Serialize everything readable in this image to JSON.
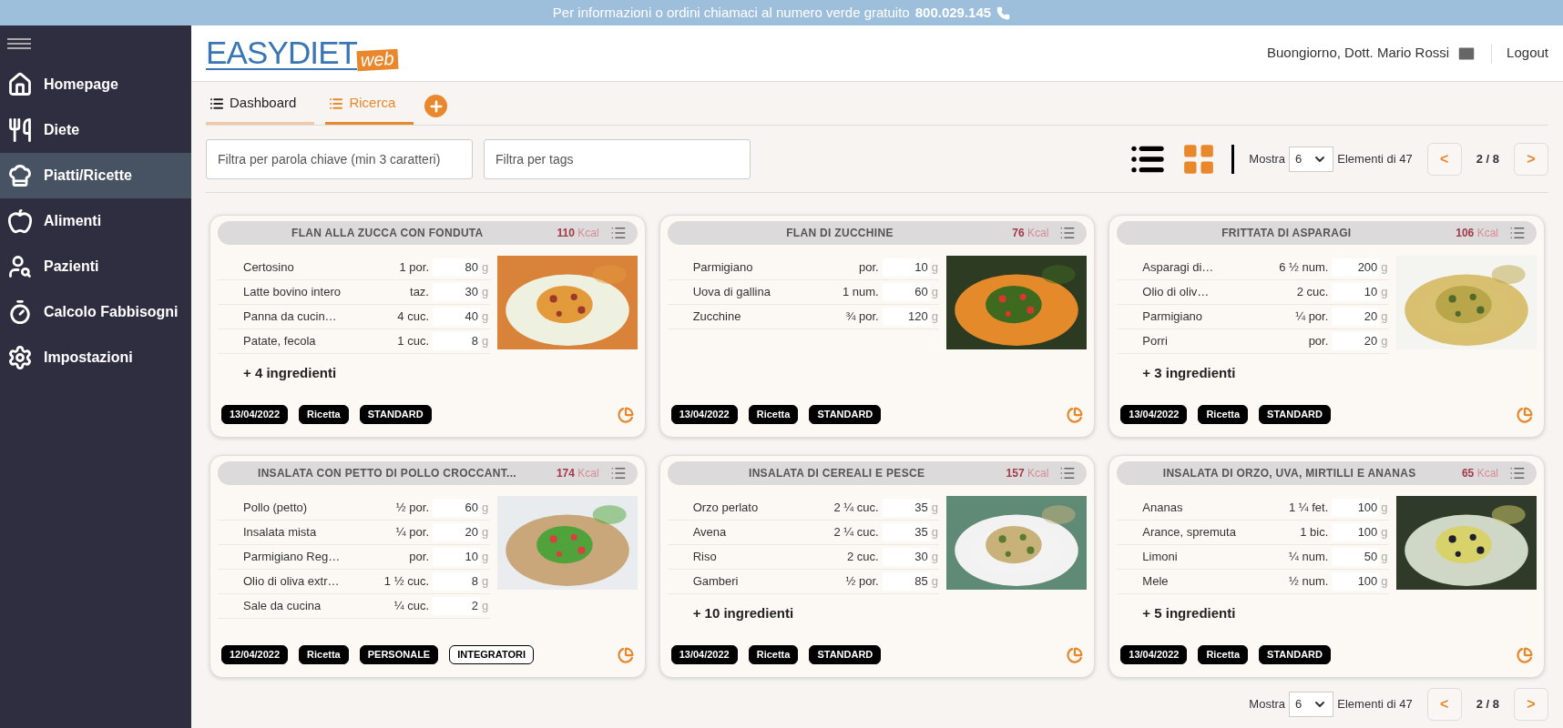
{
  "top_banner": {
    "text": "Per informazioni o ordini chiamaci al numero verde gratuito",
    "phone": "800.029.145"
  },
  "sidebar": {
    "items": [
      {
        "label": "Homepage",
        "selected": false
      },
      {
        "label": "Diete",
        "selected": false
      },
      {
        "label": "Piatti/Ricette",
        "selected": true
      },
      {
        "label": "Alimenti",
        "selected": false
      },
      {
        "label": "Pazienti",
        "selected": false
      },
      {
        "label": "Calcolo Fabbisogni",
        "selected": false
      },
      {
        "label": "Impostazioni",
        "selected": false
      }
    ]
  },
  "header": {
    "logo_main": "EASYDIET",
    "logo_badge": "web",
    "greeting": "Buongiorno, Dott. Mario Rossi",
    "logout": "Logout"
  },
  "tabs": [
    {
      "label": "Dashboard",
      "selected": false
    },
    {
      "label": "Ricerca",
      "selected": true
    }
  ],
  "filters": [
    {
      "placeholder": "Filtra per parola chiave (min 3 caratteri)"
    },
    {
      "placeholder": "Filtra per tags"
    }
  ],
  "view_modes": [
    {
      "kind": "list",
      "selected": false
    },
    {
      "kind": "grid",
      "selected": true
    }
  ],
  "pagination": {
    "show_label": "Mostra",
    "page_size": "6",
    "elements_label": "Elementi di",
    "total": "47",
    "prev": "<",
    "page": "2 / 8",
    "next": ">"
  },
  "cards": [
    {
      "title": "FLAN ALLA ZUCCA CON FONDUTA",
      "kcal": "110",
      "kcal_unit": "Kcal",
      "ingredients": [
        {
          "name": "Certosino",
          "qty": "1 por.",
          "grams": "80",
          "unit": "g"
        },
        {
          "name": "Latte bovino intero",
          "qty": "taz.",
          "grams": "30",
          "unit": "g"
        },
        {
          "name": "Panna da cucin…",
          "qty": "4 cuc.",
          "grams": "40",
          "unit": "g"
        },
        {
          "name": "Patate, fecola",
          "qty": "1 cuc.",
          "grams": "8",
          "unit": "g"
        }
      ],
      "more": "+ 4 ingredienti",
      "tags": [
        {
          "label": "13/04/2022",
          "outlined": false
        },
        {
          "label": "Ricetta",
          "outlined": false
        },
        {
          "label": "STANDARD",
          "outlined": false
        }
      ]
    },
    {
      "title": "FLAN DI ZUCCHINE",
      "kcal": "76",
      "kcal_unit": "Kcal",
      "ingredients": [
        {
          "name": "Parmigiano",
          "qty": "por.",
          "grams": "10",
          "unit": "g"
        },
        {
          "name": "Uova di gallina",
          "qty": "1 num.",
          "grams": "60",
          "unit": "g"
        },
        {
          "name": "Zucchine",
          "qty": "¾ por.",
          "grams": "120",
          "unit": "g"
        }
      ],
      "tags": [
        {
          "label": "13/04/2022",
          "outlined": false
        },
        {
          "label": "Ricetta",
          "outlined": false
        },
        {
          "label": "STANDARD",
          "outlined": false
        }
      ]
    },
    {
      "title": "FRITTATA DI ASPARAGI",
      "kcal": "106",
      "kcal_unit": "Kcal",
      "ingredients": [
        {
          "name": "Asparagi di…",
          "qty": "6 ½ num.",
          "grams": "200",
          "unit": "g"
        },
        {
          "name": "Olio di oliv…",
          "qty": "2 cuc.",
          "grams": "10",
          "unit": "g"
        },
        {
          "name": "Parmigiano",
          "qty": "¼ por.",
          "grams": "20",
          "unit": "g"
        },
        {
          "name": "Porri",
          "qty": "por.",
          "grams": "20",
          "unit": "g"
        }
      ],
      "more": "+ 3 ingredienti",
      "tags": [
        {
          "label": "13/04/2022",
          "outlined": false
        },
        {
          "label": "Ricetta",
          "outlined": false
        },
        {
          "label": "STANDARD",
          "outlined": false
        }
      ]
    },
    {
      "title": "INSALATA CON PETTO DI POLLO CROCCANT...",
      "kcal": "174",
      "kcal_unit": "Kcal",
      "ingredients": [
        {
          "name": "Pollo (petto)",
          "qty": "½ por.",
          "grams": "60",
          "unit": "g"
        },
        {
          "name": "Insalata mista",
          "qty": "¼ por.",
          "grams": "20",
          "unit": "g"
        },
        {
          "name": "Parmigiano Reg…",
          "qty": "por.",
          "grams": "10",
          "unit": "g"
        },
        {
          "name": "Olio di oliva extr…",
          "qty": "1 ½ cuc.",
          "grams": "8",
          "unit": "g"
        },
        {
          "name": "Sale da cucina",
          "qty": "¼ cuc.",
          "grams": "2",
          "unit": "g"
        }
      ],
      "tags": [
        {
          "label": "12/04/2022",
          "outlined": false
        },
        {
          "label": "Ricetta",
          "outlined": false
        },
        {
          "label": "PERSONALE",
          "outlined": false
        },
        {
          "label": "INTEGRATORI",
          "outlined": true
        }
      ]
    },
    {
      "title": "INSALATA DI CEREALI E PESCE",
      "kcal": "157",
      "kcal_unit": "Kcal",
      "ingredients": [
        {
          "name": "Orzo perlato",
          "qty": "2 ¼ cuc.",
          "grams": "35",
          "unit": "g"
        },
        {
          "name": "Avena",
          "qty": "2 ¼ cuc.",
          "grams": "35",
          "unit": "g"
        },
        {
          "name": "Riso",
          "qty": "2 cuc.",
          "grams": "30",
          "unit": "g"
        },
        {
          "name": "Gamberi",
          "qty": "½ por.",
          "grams": "85",
          "unit": "g"
        }
      ],
      "more": "+ 10 ingredienti",
      "tags": [
        {
          "label": "13/04/2022",
          "outlined": false
        },
        {
          "label": "Ricetta",
          "outlined": false
        },
        {
          "label": "STANDARD",
          "outlined": false
        }
      ]
    },
    {
      "title": "INSALATA DI ORZO, UVA, MIRTILLI E ANANAS",
      "kcal": "65",
      "kcal_unit": "Kcal",
      "ingredients": [
        {
          "name": "Ananas",
          "qty": "1 ¼ fet.",
          "grams": "100",
          "unit": "g"
        },
        {
          "name": "Arance, spremuta",
          "qty": "1 bic.",
          "grams": "100",
          "unit": "g"
        },
        {
          "name": "Limoni",
          "qty": "¼ num.",
          "grams": "50",
          "unit": "g"
        },
        {
          "name": "Mele",
          "qty": "½ num.",
          "grams": "100",
          "unit": "g"
        }
      ],
      "more": "+ 5 ingredienti",
      "tags": [
        {
          "label": "13/04/2022",
          "outlined": false
        },
        {
          "label": "Ricetta",
          "outlined": false
        },
        {
          "label": "STANDARD",
          "outlined": false
        }
      ]
    }
  ],
  "bottom_pagination": {
    "show_label": "Mostra",
    "page_size": "6",
    "elements_label": "Elementi di",
    "total": "47",
    "prev": "<",
    "page": "2 / 8",
    "next": ">"
  }
}
